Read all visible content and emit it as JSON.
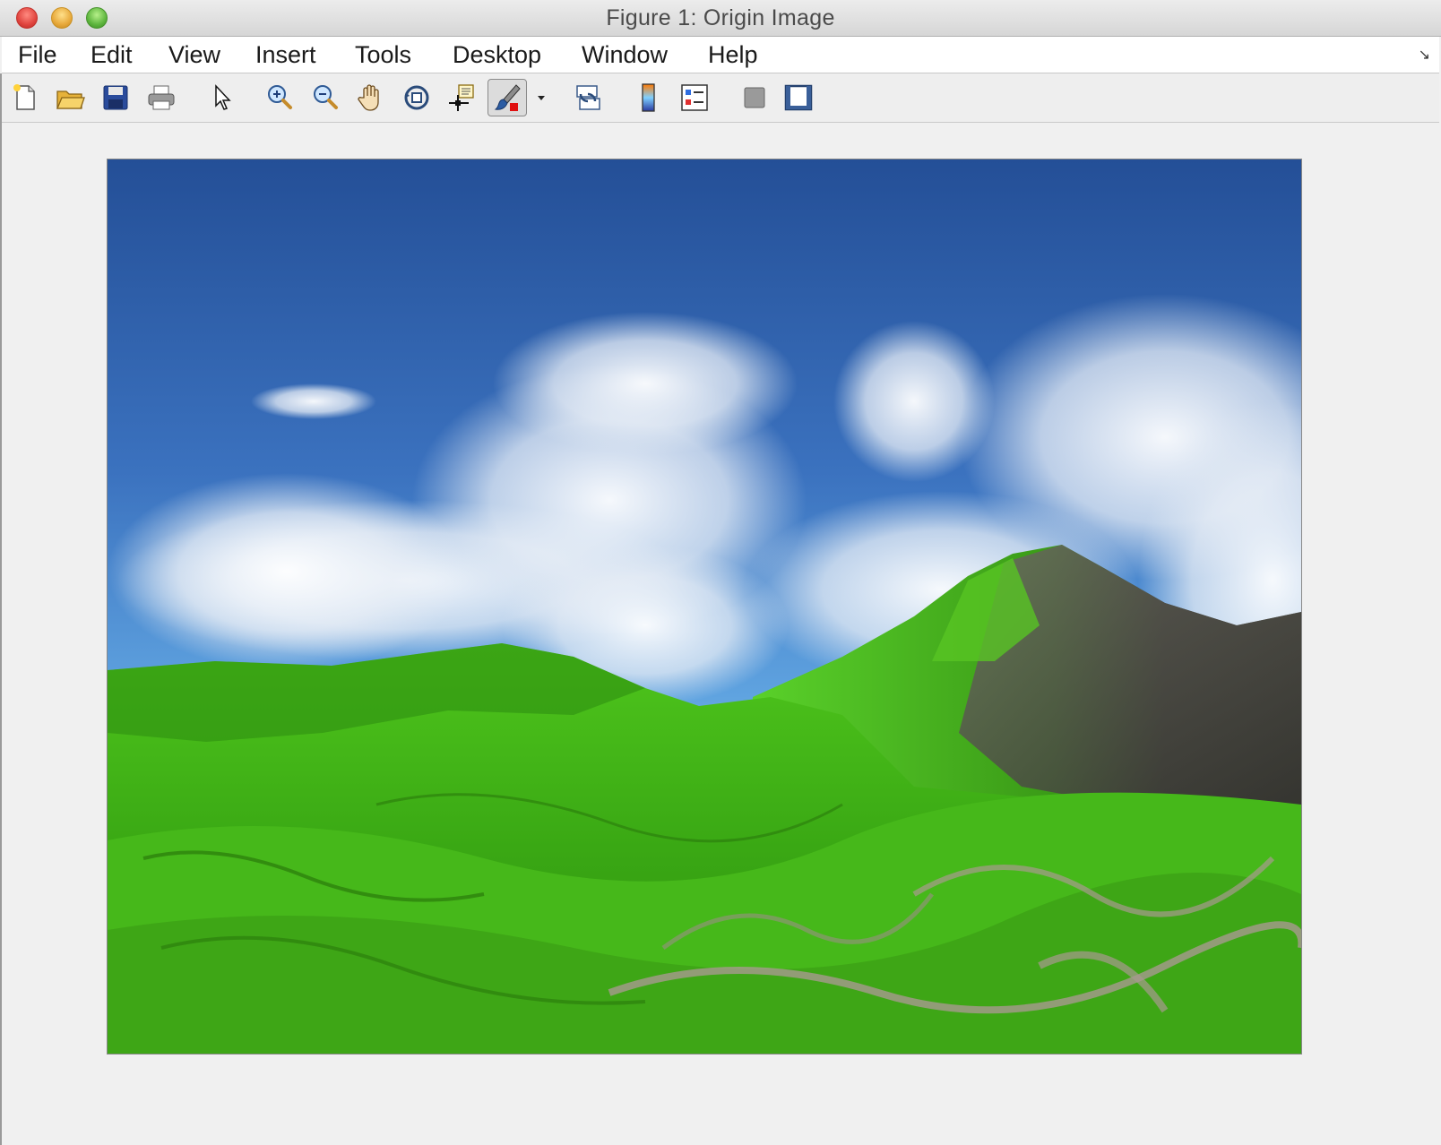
{
  "window": {
    "title": "Figure 1: Origin Image"
  },
  "menubar": {
    "items": [
      "File",
      "Edit",
      "View",
      "Insert",
      "Tools",
      "Desktop",
      "Window",
      "Help"
    ]
  },
  "toolbar": {
    "buttons": [
      {
        "name": "new-figure-icon"
      },
      {
        "name": "open-file-icon"
      },
      {
        "name": "save-figure-icon"
      },
      {
        "name": "print-figure-icon"
      },
      {
        "name": "edit-plot-arrow-icon"
      },
      {
        "name": "zoom-in-icon"
      },
      {
        "name": "zoom-out-icon"
      },
      {
        "name": "pan-hand-icon"
      },
      {
        "name": "rotate-3d-icon"
      },
      {
        "name": "data-cursor-icon"
      },
      {
        "name": "brush-icon",
        "pressed": true
      },
      {
        "name": "link-plot-icon"
      },
      {
        "name": "insert-colorbar-icon"
      },
      {
        "name": "insert-legend-icon"
      },
      {
        "name": "hide-plot-tools-icon"
      },
      {
        "name": "show-plot-tools-icon"
      }
    ]
  },
  "image": {
    "description_icon": "landscape-image",
    "colors": {
      "sky_top": "#2f5fa6",
      "sky_bottom": "#6fb0e6",
      "grass": "#3fbf16",
      "grass_dark": "#1c6e0c",
      "rock": "#4a4a44"
    }
  }
}
